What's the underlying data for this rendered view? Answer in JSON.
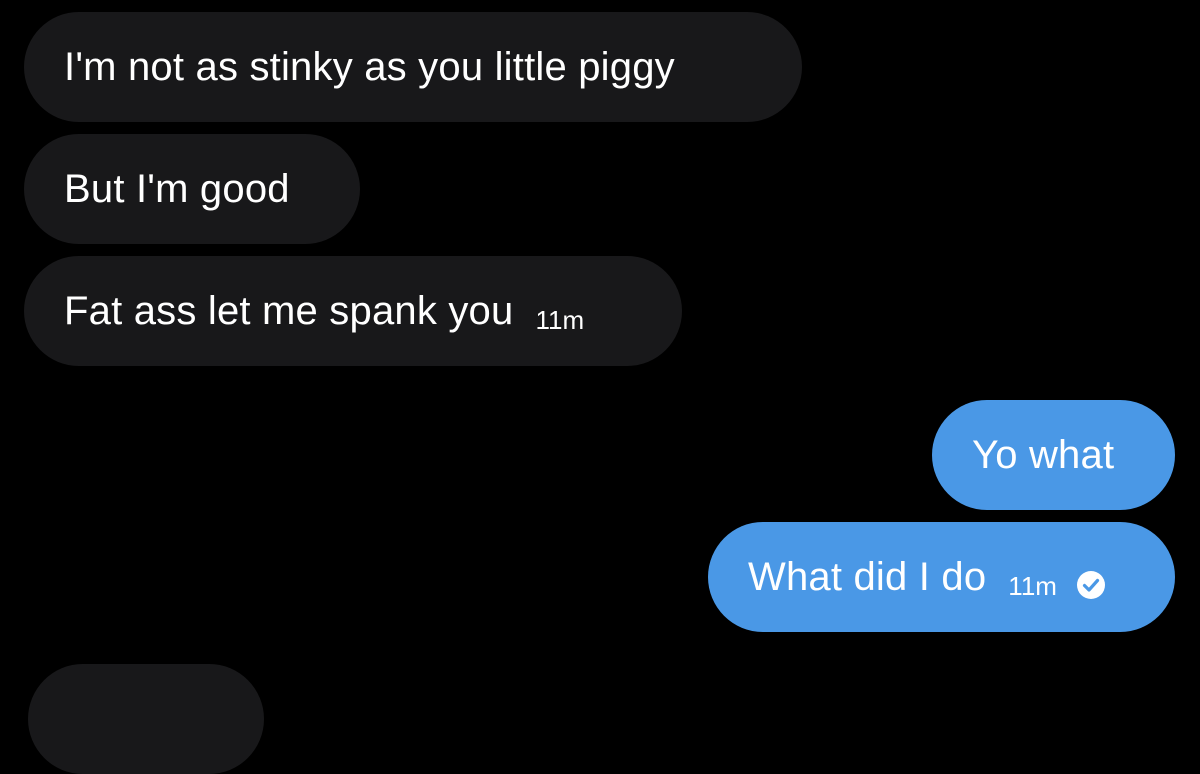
{
  "colors": {
    "background": "#000000",
    "incoming_bubble": "#18181a",
    "outgoing_bubble": "#4a98e6",
    "text": "#ffffff"
  },
  "messages": [
    {
      "direction": "incoming",
      "text": "I'm not as stinky as you little piggy"
    },
    {
      "direction": "incoming",
      "text": "But I'm good"
    },
    {
      "direction": "incoming",
      "text": "Fat ass let me spank you",
      "time": "11m"
    },
    {
      "direction": "outgoing",
      "text": "Yo what"
    },
    {
      "direction": "outgoing",
      "text": "What did I do",
      "time": "11m",
      "status_icon": "read-check-icon"
    }
  ]
}
